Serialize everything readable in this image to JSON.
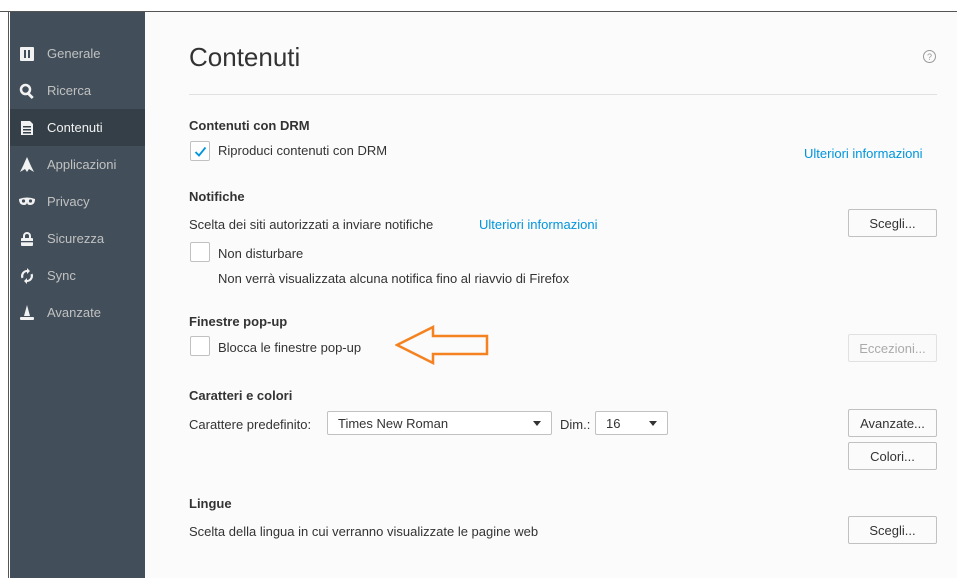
{
  "sidebar": {
    "items": [
      {
        "label": "Generale",
        "icon": "general-icon"
      },
      {
        "label": "Ricerca",
        "icon": "search-icon"
      },
      {
        "label": "Contenuti",
        "icon": "content-icon",
        "active": true
      },
      {
        "label": "Applicazioni",
        "icon": "applications-icon"
      },
      {
        "label": "Privacy",
        "icon": "privacy-mask-icon"
      },
      {
        "label": "Sicurezza",
        "icon": "security-lock-icon"
      },
      {
        "label": "Sync",
        "icon": "sync-icon"
      },
      {
        "label": "Avanzate",
        "icon": "advanced-wizard-icon"
      }
    ]
  },
  "page": {
    "title": "Contenuti",
    "help_icon_glyph": "?"
  },
  "drm": {
    "heading": "Contenuti con DRM",
    "checkbox_label": "Riproduci contenuti con DRM",
    "checked": true,
    "more_link": "Ulteriori informazioni"
  },
  "notifications": {
    "heading": "Notifiche",
    "description": "Scelta dei siti autorizzati a inviare notifiche",
    "more_link": "Ulteriori informazioni",
    "choose_button": "Scegli...",
    "dnd_label": "Non disturbare",
    "dnd_checked": false,
    "dnd_note": "Non verrà visualizzata alcuna notifica fino al riavvio di Firefox"
  },
  "popups": {
    "heading": "Finestre pop-up",
    "block_label": "Blocca le finestre pop-up",
    "block_checked": false,
    "exceptions_button": "Eccezioni...",
    "annotation_arrow_color": "#f58220"
  },
  "fonts": {
    "heading": "Caratteri e colori",
    "default_font_label": "Carattere predefinito:",
    "default_font_value": "Times New Roman",
    "size_label": "Dim.:",
    "size_value": "16",
    "advanced_button": "Avanzate...",
    "colors_button": "Colori..."
  },
  "languages": {
    "heading": "Lingue",
    "description": "Scelta della lingua in cui verranno visualizzate le pagine web",
    "choose_button": "Scegli..."
  },
  "colors": {
    "sidebar_bg": "#424f5a",
    "sidebar_active": "#343f48",
    "link": "#0095dd",
    "checkmark": "#0095dd"
  }
}
